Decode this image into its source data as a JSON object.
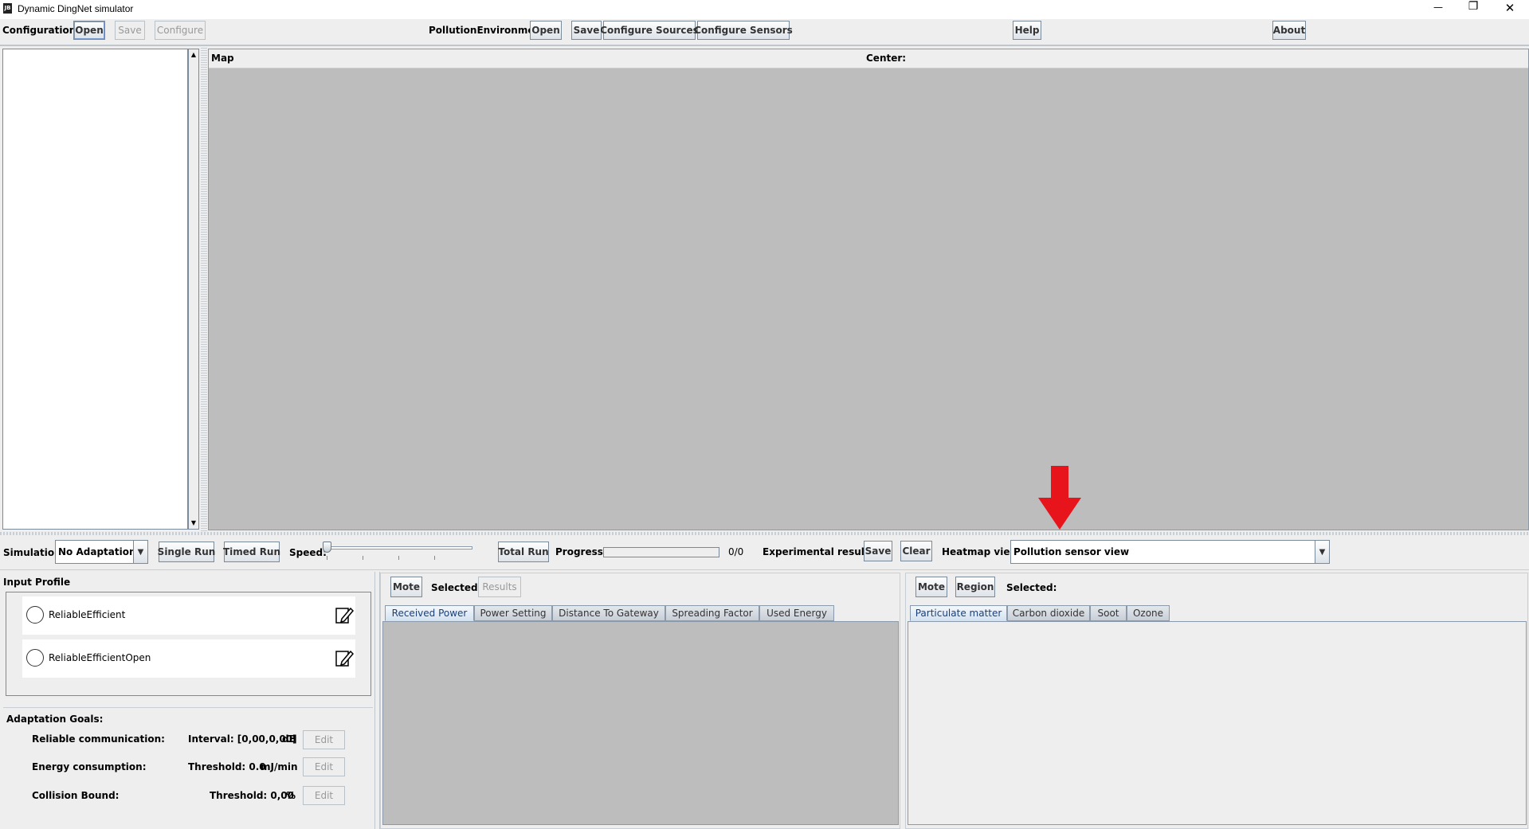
{
  "window": {
    "title": "Dynamic DingNet simulator",
    "app_icon": "java-app-icon",
    "controls": {
      "minimize": "—",
      "restore": "❐",
      "close": "✕"
    }
  },
  "toolbar": {
    "configuration_label": "Configuration:",
    "open": "Open",
    "save": "Save",
    "configure": "Configure",
    "pollution_label": "PollutionEnvironment:",
    "p_open": "Open",
    "p_save": "Save",
    "configure_sources": "Configure Sources",
    "configure_sensors": "Configure Sensors",
    "help": "Help",
    "about": "About"
  },
  "map": {
    "title": "Map",
    "center_label": "Center:"
  },
  "sim_bar": {
    "simulation_label": "Simulation",
    "adaptation_value": "No Adaptation",
    "single_run": "Single Run",
    "timed_run": "Timed Run",
    "speed_label": "Speed:",
    "speed_fraction": 0.0,
    "total_run": "Total Run",
    "progress_label": "Progress:",
    "progress_fraction": 0,
    "progress_text": "0/0",
    "results_label": "Experimental results:",
    "results_save": "Save",
    "results_clear": "Clear",
    "heatmap_label": "Heatmap view:",
    "heatmap_value": "Pollution sensor view"
  },
  "input_profile": {
    "title": "Input Profile",
    "profiles": [
      {
        "name": "ReliableEfficient"
      },
      {
        "name": "ReliableEfficientOpen"
      }
    ]
  },
  "adaptation_goals": {
    "title": "Adaptation Goals:",
    "goals": [
      {
        "name": "Reliable communication:",
        "value": "Interval: [0,00,0,00]",
        "unit": "dB",
        "edit": "Edit"
      },
      {
        "name": "Energy consumption:",
        "value": "Threshold: 0.0",
        "unit": "mJ/min",
        "edit": "Edit"
      },
      {
        "name": "Collision Bound:",
        "value": "Threshold: 0,00",
        "unit": "%",
        "edit": "Edit"
      }
    ]
  },
  "mote_panel": {
    "mote": "Mote",
    "selected_label": "Selected:",
    "results": "Results",
    "tabs": [
      "Received Power",
      "Power Setting",
      "Distance To Gateway",
      "Spreading Factor",
      "Used Energy"
    ]
  },
  "region_panel": {
    "mote": "Mote",
    "region": "Region",
    "selected_label": "Selected:",
    "tabs": [
      "Particulate matter",
      "Carbon dioxide",
      "Soot",
      "Ozone"
    ]
  },
  "annotation": {
    "color": "#e8141b",
    "icon": "red-down-arrow"
  }
}
